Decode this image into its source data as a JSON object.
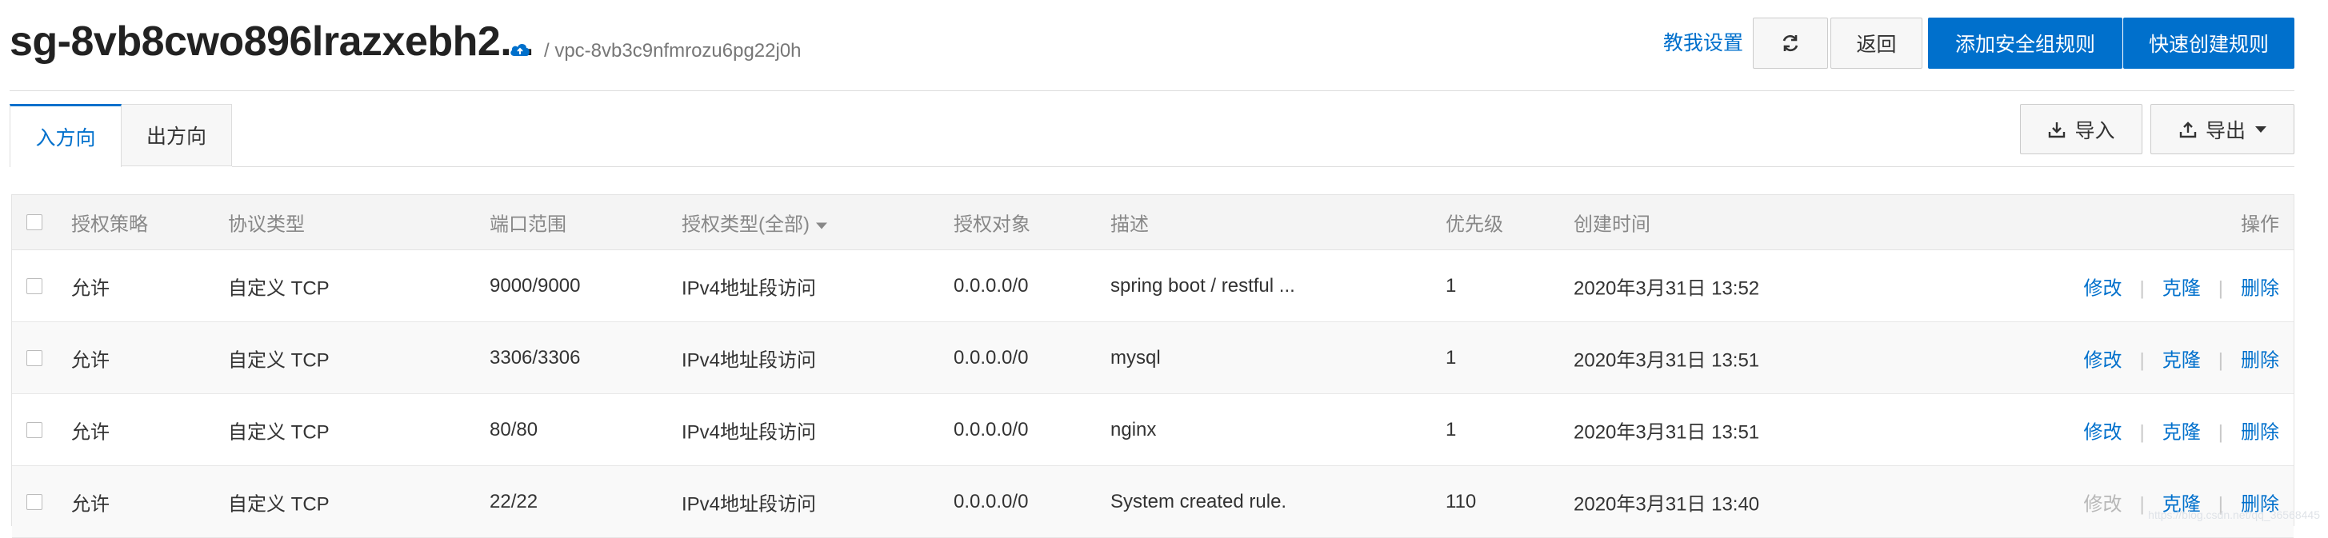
{
  "header": {
    "sg_id": "sg-8vb8cwo896lrazxebh2...",
    "vpc_id": "/ vpc-8vb3c9nfmrozu6pg22j0h",
    "help_link": "教我设置",
    "back_label": "返回",
    "add_rule_label": "添加安全组规则",
    "quick_rule_label": "快速创建规则",
    "refresh_icon": "refresh-icon",
    "cloud_icon": "cloud-icon"
  },
  "tabs": {
    "inbound": "入方向",
    "outbound": "出方向",
    "active": "inbound"
  },
  "toolbar": {
    "import_label": "导入",
    "export_label": "导出"
  },
  "table": {
    "columns": {
      "policy": "授权策略",
      "protocol": "协议类型",
      "port": "端口范围",
      "auth_type": "授权类型(全部)",
      "auth_object": "授权对象",
      "description": "描述",
      "priority": "优先级",
      "created": "创建时间",
      "actions": "操作"
    },
    "rows": [
      {
        "policy": "允许",
        "protocol": "自定义 TCP",
        "port": "9000/9000",
        "auth_type": "IPv4地址段访问",
        "auth_object": "0.0.0.0/0",
        "description": "spring boot / restful ...",
        "priority": "1",
        "created": "2020年3月31日 13:52",
        "edit": "修改",
        "clone": "克隆",
        "delete": "删除",
        "edit_disabled": false
      },
      {
        "policy": "允许",
        "protocol": "自定义 TCP",
        "port": "3306/3306",
        "auth_type": "IPv4地址段访问",
        "auth_object": "0.0.0.0/0",
        "description": "mysql",
        "priority": "1",
        "created": "2020年3月31日 13:51",
        "edit": "修改",
        "clone": "克隆",
        "delete": "删除",
        "edit_disabled": false
      },
      {
        "policy": "允许",
        "protocol": "自定义 TCP",
        "port": "80/80",
        "auth_type": "IPv4地址段访问",
        "auth_object": "0.0.0.0/0",
        "description": "nginx",
        "priority": "1",
        "created": "2020年3月31日 13:51",
        "edit": "修改",
        "clone": "克隆",
        "delete": "删除",
        "edit_disabled": false
      },
      {
        "policy": "允许",
        "protocol": "自定义 TCP",
        "port": "22/22",
        "auth_type": "IPv4地址段访问",
        "auth_object": "0.0.0.0/0",
        "description": "System created rule.",
        "priority": "110",
        "created": "2020年3月31日 13:40",
        "edit": "修改",
        "clone": "克隆",
        "delete": "删除",
        "edit_disabled": true
      }
    ],
    "action_separator": "|"
  },
  "colors": {
    "primary": "#0070cc",
    "disabled_link": "#b8b8b8",
    "header_bg": "#f4f4f4"
  }
}
